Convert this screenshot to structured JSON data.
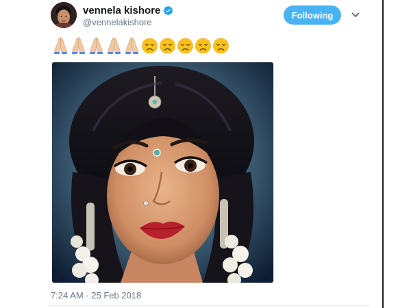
{
  "tweet": {
    "author": {
      "display_name": "vennela kishore",
      "handle": "@vennelakishore",
      "verified": true,
      "avatar_icon": "profile-photo"
    },
    "follow_button_label": "Following",
    "menu_icon": "chevron-down-icon",
    "emoji_text": [
      {
        "icon": "folded-hands-emoji"
      },
      {
        "icon": "folded-hands-emoji"
      },
      {
        "icon": "folded-hands-emoji"
      },
      {
        "icon": "folded-hands-emoji"
      },
      {
        "icon": "folded-hands-emoji"
      },
      {
        "icon": "disappointed-face-emoji"
      },
      {
        "icon": "disappointed-face-emoji"
      },
      {
        "icon": "disappointed-face-emoji"
      },
      {
        "icon": "disappointed-face-emoji"
      },
      {
        "icon": "disappointed-face-emoji"
      }
    ],
    "media": {
      "kind": "photo"
    },
    "timestamp": "7:24 AM - 25 Feb 2018"
  },
  "colors": {
    "follow_button_bg": "#4ab3f4",
    "verified_badge": "#1da1f2",
    "secondary_text": "#657786",
    "primary_text": "#14171a"
  }
}
